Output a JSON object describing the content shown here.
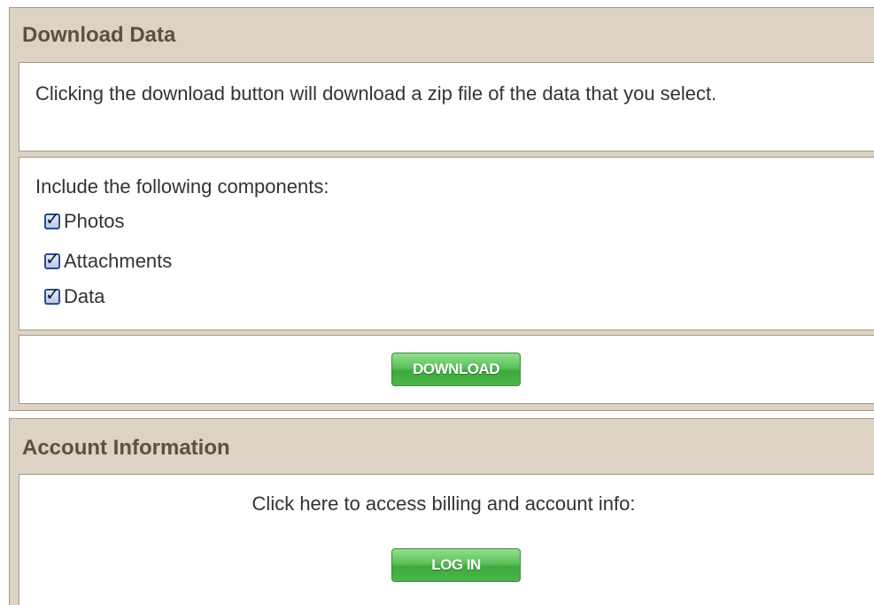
{
  "download_panel": {
    "title": "Download Data",
    "intro": "Clicking the download button will download a zip file of the data that you select.",
    "components_label": "Include the following components:",
    "components": [
      {
        "label": "Photos",
        "checked": true
      },
      {
        "label": "Attachments",
        "checked": true
      },
      {
        "label": "Data",
        "checked": true
      }
    ],
    "download_label": "DOWNLOAD"
  },
  "account_panel": {
    "title": "Account Information",
    "text": "Click here to access billing and account info:",
    "login_label": "LOG IN"
  },
  "colors": {
    "panel_bg": "#ddd3c5",
    "title_text": "#5a5043",
    "button_green": "#4bb64a"
  }
}
